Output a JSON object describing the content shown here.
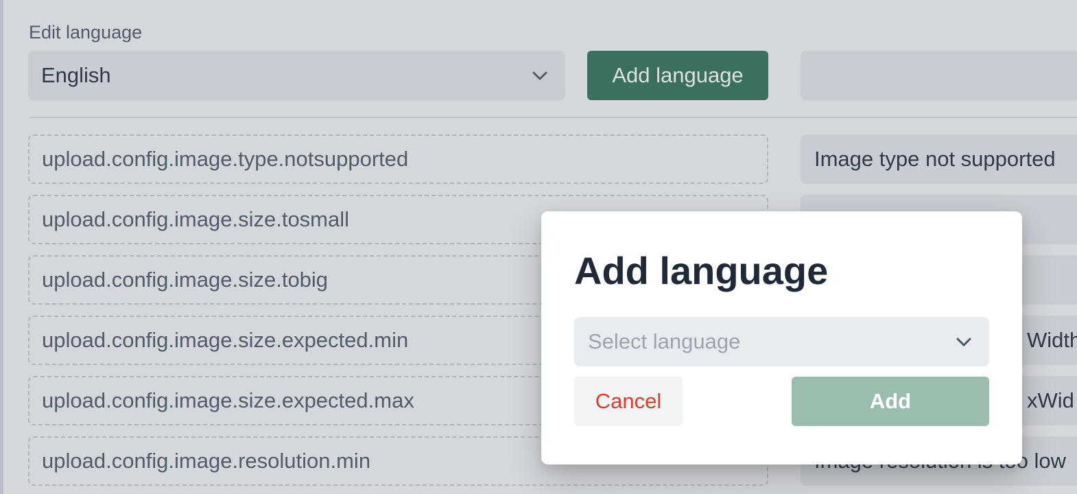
{
  "editor": {
    "edit_label": "Edit language",
    "selected_language": "English",
    "add_language_button": "Add language"
  },
  "rows": [
    {
      "key": "upload.config.image.type.notsupported",
      "value": "Image type not supported"
    },
    {
      "key": "upload.config.image.size.tosmall",
      "value": ""
    },
    {
      "key": "upload.config.image.size.tobig",
      "value": ""
    },
    {
      "key": "upload.config.image.size.expected.min",
      "value": "Width"
    },
    {
      "key": "upload.config.image.size.expected.max",
      "value": "xWid"
    },
    {
      "key": "upload.config.image.resolution.min",
      "value": "Image resolution is too low"
    }
  ],
  "modal": {
    "title": "Add language",
    "select_placeholder": "Select language",
    "cancel_label": "Cancel",
    "add_label": "Add"
  },
  "colors": {
    "primary": "#2f6f55",
    "primary_disabled": "#9bbdae",
    "danger": "#dc3a2a"
  },
  "icons": {
    "select_chevron": "chevron-down-icon"
  }
}
